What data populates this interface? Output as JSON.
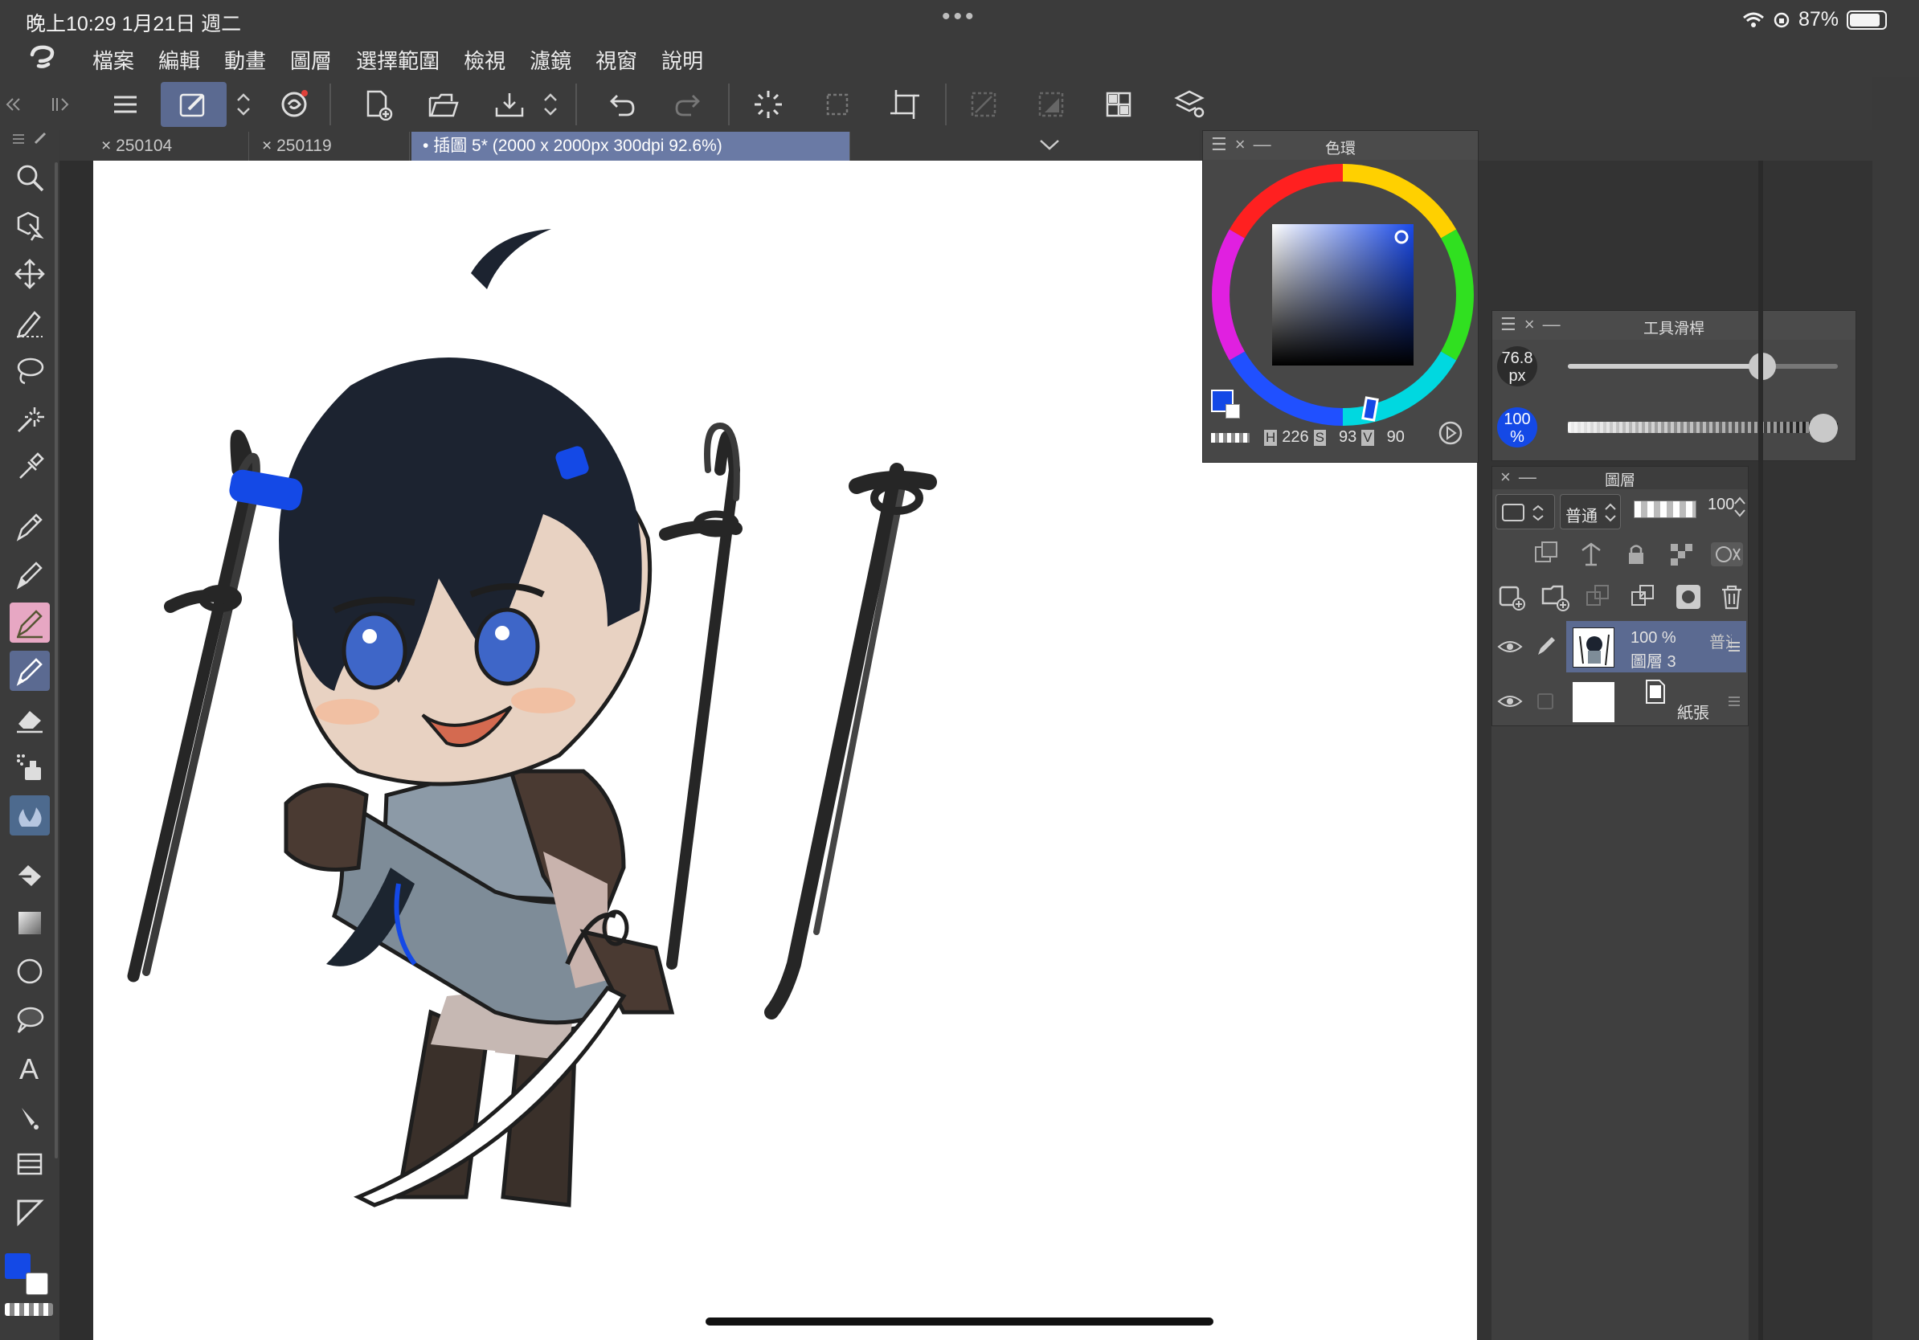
{
  "status": {
    "time": "晚上10:29  1月21日 週二",
    "battery": "87%",
    "dots": "•••"
  },
  "menu": [
    "檔案",
    "編輯",
    "動畫",
    "圖層",
    "選擇範圍",
    "檢視",
    "濾鏡",
    "視窗",
    "說明"
  ],
  "tabs": [
    {
      "label": "250104",
      "close": "×"
    },
    {
      "label": "250119",
      "close": "×"
    },
    {
      "label": "插圖 5* (2000 x 2000px 300dpi 92.6%)",
      "close": "•"
    }
  ],
  "color_wheel": {
    "title": "色環",
    "h_label": "H",
    "h": "226",
    "s_label": "S",
    "s": "93",
    "v_label": "V",
    "v": "90",
    "main_color": "#1449e6",
    "sub_color": "#ffffff"
  },
  "tool_slider": {
    "title": "工具滑桿",
    "size_value": "76.8",
    "size_unit": "px",
    "opacity_value": "100",
    "opacity_unit": "%",
    "size_level": 0.72,
    "opacity_level": 1.0
  },
  "layers": {
    "title": "圖層",
    "blend_mode": "普通",
    "opacity": "100",
    "items": [
      {
        "opacity": "100 %",
        "mode": "普通",
        "name": "圖層 3",
        "selected": true
      },
      {
        "name": "紙張",
        "selected": false
      }
    ]
  },
  "colors": {
    "accent": "#5b6a91",
    "main_color": "#1449e6",
    "panel": "#474747",
    "bg": "#3b3b3b"
  }
}
